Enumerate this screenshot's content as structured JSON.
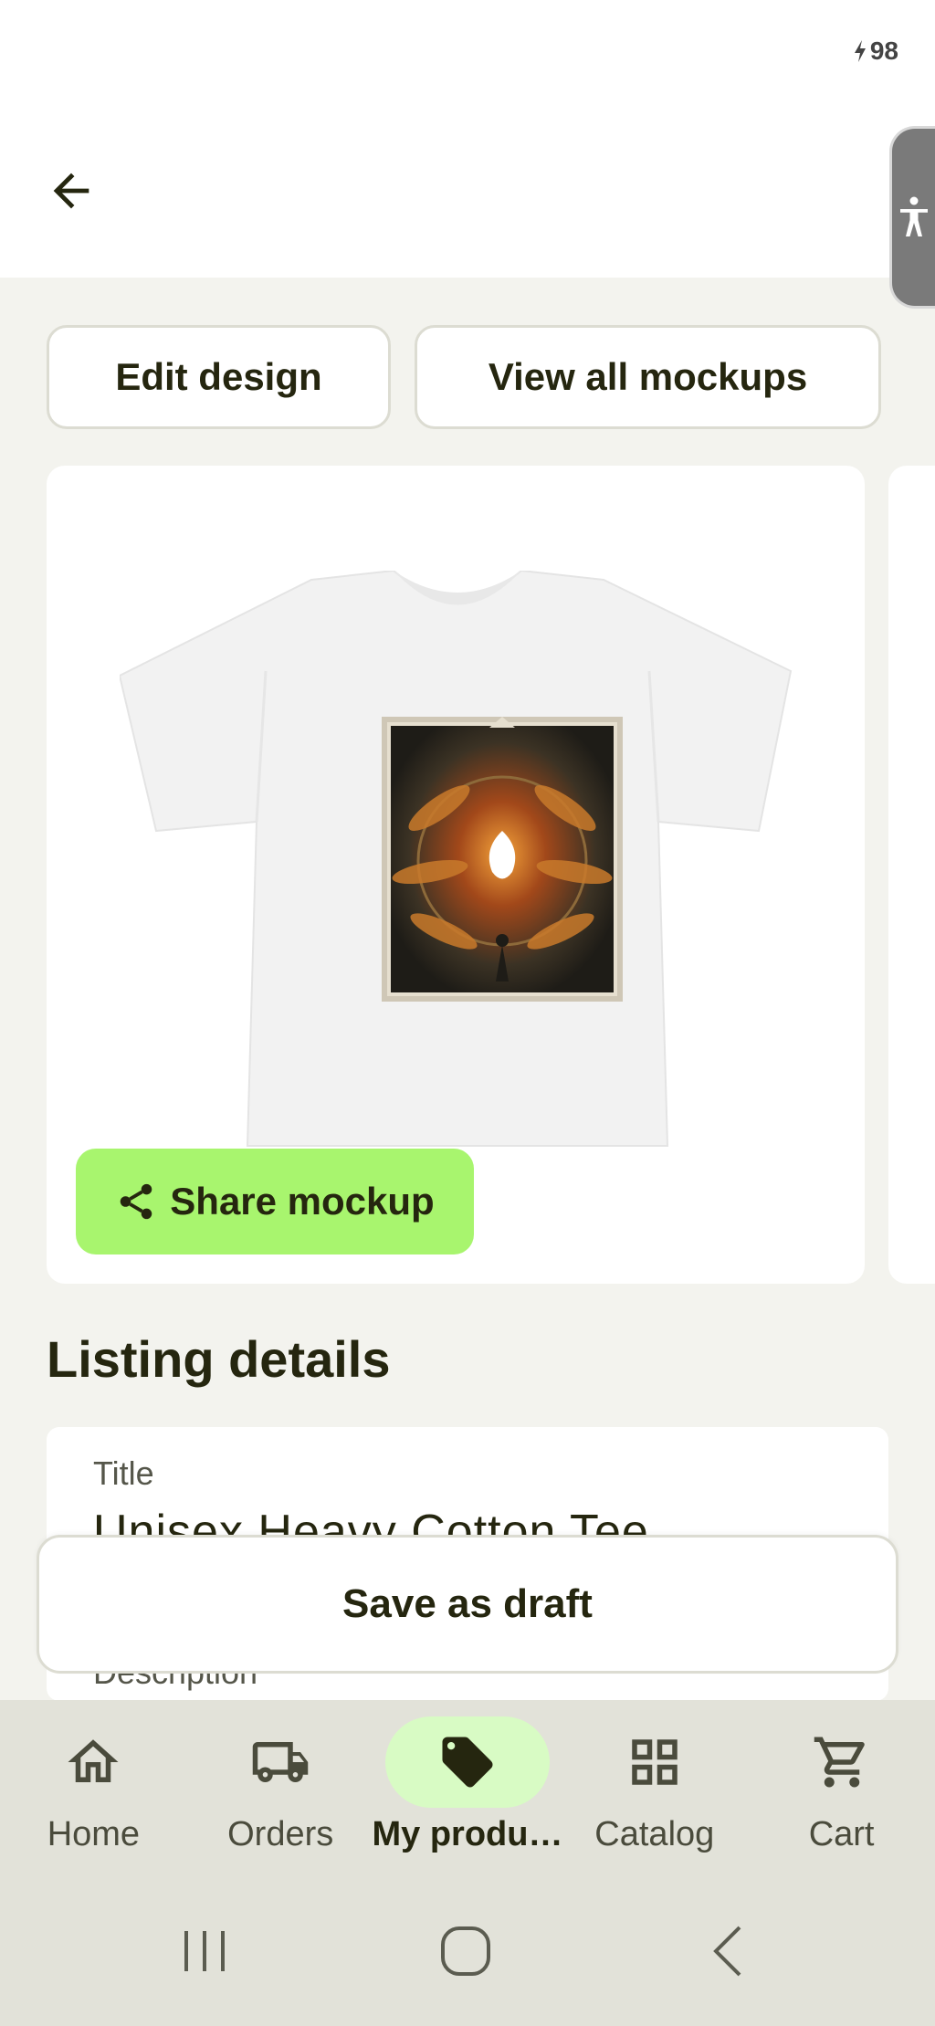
{
  "status_bar": {
    "battery_level": "98"
  },
  "actions": {
    "edit_design_label": "Edit design",
    "view_mockups_label": "View all mockups"
  },
  "mockup": {
    "share_label": "Share mockup"
  },
  "listing": {
    "section_title": "Listing details",
    "title_label": "Title",
    "title_value": "Unisex Heavy Cotton Tee",
    "description_label": "Description"
  },
  "footer": {
    "save_draft_label": "Save as draft"
  },
  "bottom_nav": {
    "items": [
      {
        "label": "Home",
        "icon": "home-icon"
      },
      {
        "label": "Orders",
        "icon": "truck-icon"
      },
      {
        "label": "My produ…",
        "icon": "tag-icon",
        "active": true
      },
      {
        "label": "Catalog",
        "icon": "grid-icon"
      },
      {
        "label": "Cart",
        "icon": "cart-icon"
      }
    ]
  },
  "colors": {
    "accent_green": "#a8f56e",
    "active_pill": "#d8fbc4",
    "text_dark": "#25260f",
    "nav_bg": "#e2e2d9"
  }
}
